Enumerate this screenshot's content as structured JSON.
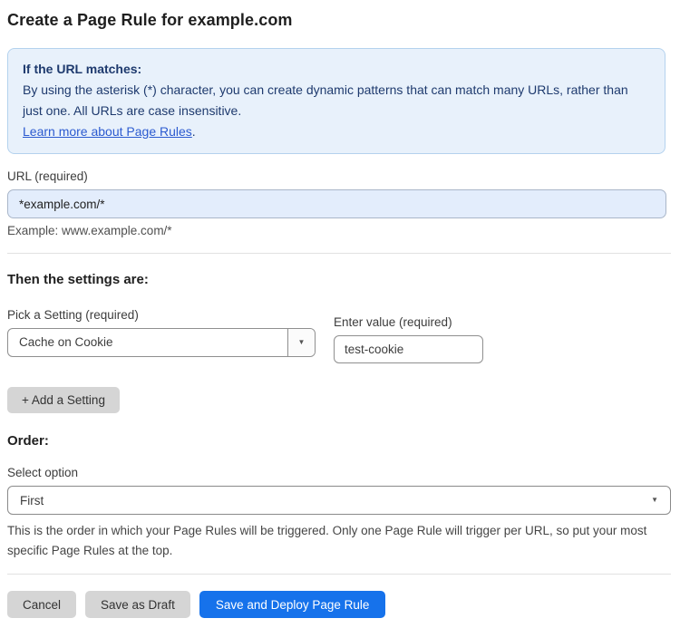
{
  "page": {
    "title": "Create a Page Rule for example.com"
  },
  "info_box": {
    "heading": "If the URL matches:",
    "body": "By using the asterisk (*) character, you can create dynamic patterns that can match many URLs, rather than just one. All URLs are case insensitive.",
    "link_label": "Learn more about Page Rules",
    "link_suffix": "."
  },
  "url_field": {
    "label": "URL (required)",
    "value": "*example.com/*",
    "helper": "Example: www.example.com/*"
  },
  "settings_section": {
    "heading": "Then the settings are:",
    "setting_label": "Pick a Setting (required)",
    "setting_value": "Cache on Cookie",
    "value_label": "Enter value (required)",
    "value_value": "test-cookie",
    "add_setting_label": "+ Add a Setting"
  },
  "order_section": {
    "heading": "Order:",
    "select_label": "Select option",
    "select_value": "First",
    "helper": "This is the order in which your Page Rules will be triggered. Only one Page Rule will trigger per URL, so put your most specific Page Rules at the top."
  },
  "actions": {
    "cancel_label": "Cancel",
    "save_draft_label": "Save as Draft",
    "save_deploy_label": "Save and Deploy Page Rule"
  },
  "icons": {
    "dropdown_arrow": "▼"
  },
  "colors": {
    "info_box_bg": "#e8f1fb",
    "info_box_border": "#b4d2ee",
    "info_text": "#1e3a6e",
    "link_blue": "#2c5bd0",
    "url_input_bg": "#e3edfc",
    "primary_button_blue": "#1672eb",
    "gray_button": "#d5d5d5"
  }
}
